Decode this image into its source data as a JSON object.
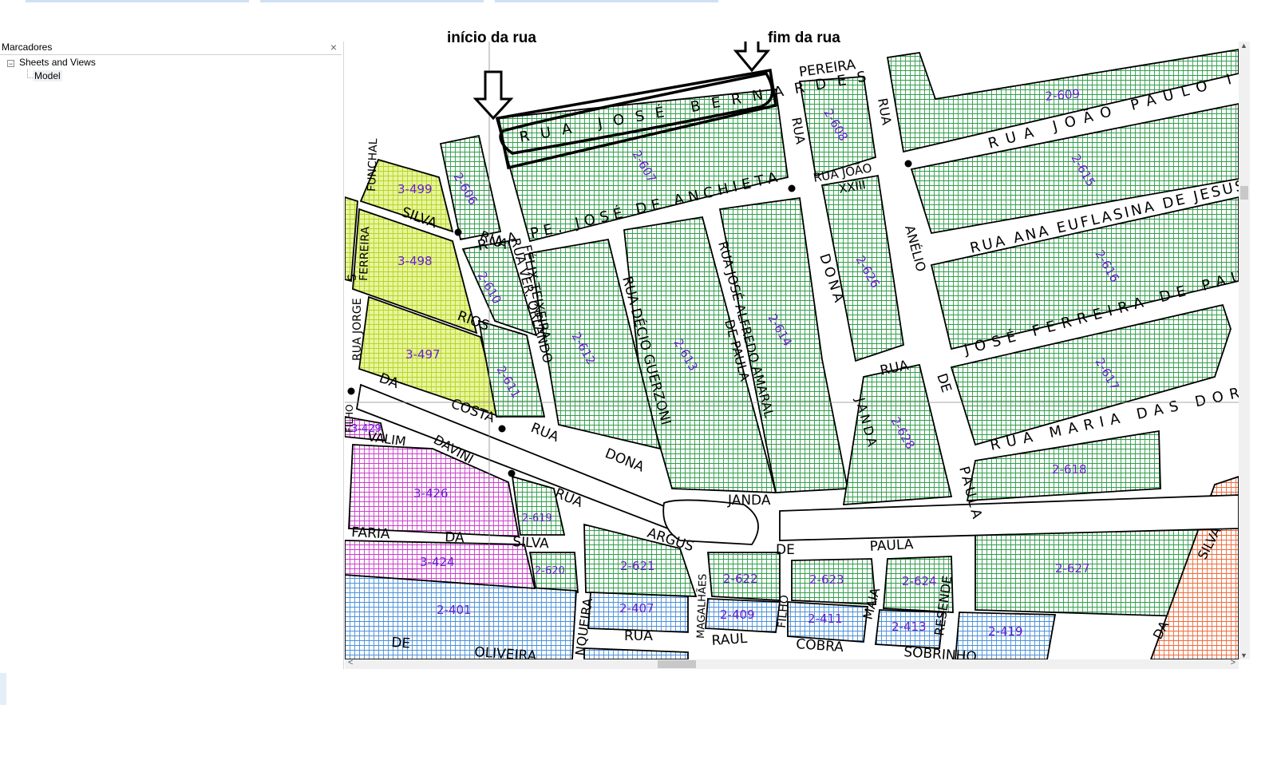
{
  "panel": {
    "title": "Marcadores",
    "close_symbol": "×",
    "tree_expander": "−",
    "tree_root": "Sheets and Views",
    "tree_leaf": "Model"
  },
  "annotations": {
    "start": "início da rua",
    "end": "fim da rua"
  },
  "scrollbars": {
    "up": "▲",
    "down": "▼",
    "left": "<",
    "right": ">"
  },
  "map": {
    "streets": {
      "jose_bernardes": "RUA JOSÉ BERNARDES",
      "pereira": "PEREIRA",
      "joao_paulo": "RUA JOÃO PAULO II",
      "anchieta": "RUA PE. JOSÉ DE ANCHIETA",
      "joao_xxiii_a": "RUA JOÃO",
      "joao_xxiii_b": "XXIII",
      "rua_v1": "RUA",
      "rua_v2": "RUA",
      "ana_euflasina": "RUA ANA EUFLASINA DE JESUS",
      "anelio": "ANÉLIO",
      "dona": "DONA",
      "jose_ferreira": "JOSÉ FERREIRA DE PAULA",
      "rua_de": "RUA",
      "de": "DE",
      "maria_das_dores": "RUA MARIA DAS DORES",
      "janda": "JANDA",
      "janda2": "JANDA",
      "paula": "PAULA",
      "de_paula": "DE",
      "paula2": "PAULA",
      "resende": "RESENDE",
      "maia": "MAIA",
      "sobrinho": "SOBRINHO",
      "cobra": "COBRA",
      "raul": "RAUL",
      "filho": "FILHO",
      "magalhaes": "MAGALHÃES",
      "rua_b": "RUA",
      "nqueira": "NQUEIRA",
      "oliveira": "OLIVEIRA",
      "de_b": "DE",
      "faria": "FARIA",
      "da": "DA",
      "silva": "SILVA",
      "argus": "ARGUS",
      "rua_argus": "RUA",
      "dona2": "DONA",
      "rua_c": "RUA",
      "costa": "COSTA",
      "da2": "DA",
      "davini": "DAVINI",
      "valim": "VALIM",
      "rios": "RIOS",
      "silva2": "SILVA",
      "rua_d": "RUA",
      "funchal": "FUNCHAL",
      "ferreira": "FERREIRA",
      "jorge": "RUA JORGE",
      "s_letter": "S",
      "filho2": "FILHO",
      "felix": "FÉLIX TEIXEIRA",
      "orlando": "RUA VER. ORLANDO",
      "decio": "RUA DÉCIO GUERZONI",
      "jose_alfredo": "RUA JOSÉ ALFREDO AMARAL",
      "de_paula_v": "DE PAULA",
      "silva_right": "SILVA",
      "da_right": "DA"
    },
    "lots": [
      "2-609",
      "2-608",
      "2-607",
      "2-606",
      "2-615",
      "2-616",
      "2-617",
      "2-618",
      "2-626",
      "2-614",
      "2-613",
      "2-612",
      "2-610",
      "2-611",
      "2-628",
      "2-619",
      "2-620",
      "2-621",
      "2-622",
      "2-623",
      "2-624",
      "2-627",
      "2-401",
      "2-407",
      "2-409",
      "2-411",
      "2-413",
      "2-419",
      "3-499",
      "3-498",
      "3-497",
      "3-429",
      "3-426",
      "3-424"
    ]
  }
}
